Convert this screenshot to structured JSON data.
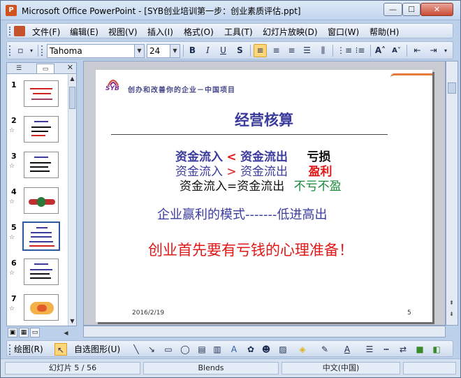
{
  "window": {
    "title": "Microsoft Office PowerPoint - [SYB创业培训第一步：创业素质评估.ppt]",
    "app_icon": "P",
    "minimize": "—",
    "maximize": "☐",
    "close": "✕"
  },
  "menu": {
    "items": [
      "文件(F)",
      "编辑(E)",
      "视图(V)",
      "插入(I)",
      "格式(O)",
      "工具(T)",
      "幻灯片放映(D)",
      "窗口(W)",
      "帮助(H)"
    ]
  },
  "format_toolbar": {
    "font_name": "Tahoma",
    "font_size": "24",
    "bold": "B",
    "italic": "I",
    "underline": "U",
    "shadow": "S",
    "grow_font": "A˄",
    "shrink_font": "A˅"
  },
  "left_pane": {
    "tab_outline": "☰",
    "tab_slides": "▭",
    "close": "✕",
    "thumbnails": [
      {
        "number": "1",
        "star": ""
      },
      {
        "number": "2",
        "star": "☆"
      },
      {
        "number": "3",
        "star": "☆"
      },
      {
        "number": "4",
        "star": "☆"
      },
      {
        "number": "5",
        "star": "☆"
      },
      {
        "number": "6",
        "star": "☆"
      },
      {
        "number": "7",
        "star": "☆"
      }
    ]
  },
  "slide": {
    "logo_text": "SYB",
    "header": "创办和改善你的企业－中国项目",
    "title": "经营核算",
    "line1_a": "资金流入",
    "line1_op": "<",
    "line1_b": "资金流出",
    "line1_result": "亏损",
    "line2_a": "资金流入",
    "line2_op": ">",
    "line2_b": "资金流出",
    "line2_result": "盈利",
    "line3": "资金流入=资金流出",
    "line3_result": "不亏不盈",
    "model": "企业赢利的模式-------低进高出",
    "warning": "创业首先要有亏钱的心理准备！",
    "footer_date": "2016/2/19",
    "footer_page": "5"
  },
  "draw_toolbar": {
    "draw_menu": "绘图(R)",
    "autoshape_menu": "自选图形(U)"
  },
  "status": {
    "slide_pos": "幻灯片 5 / 56",
    "design": "Blends",
    "language": "中文(中国)"
  },
  "colors": {
    "title_blue": "#3b3b9e",
    "red": "#e01818",
    "green": "#1a8a3a"
  }
}
